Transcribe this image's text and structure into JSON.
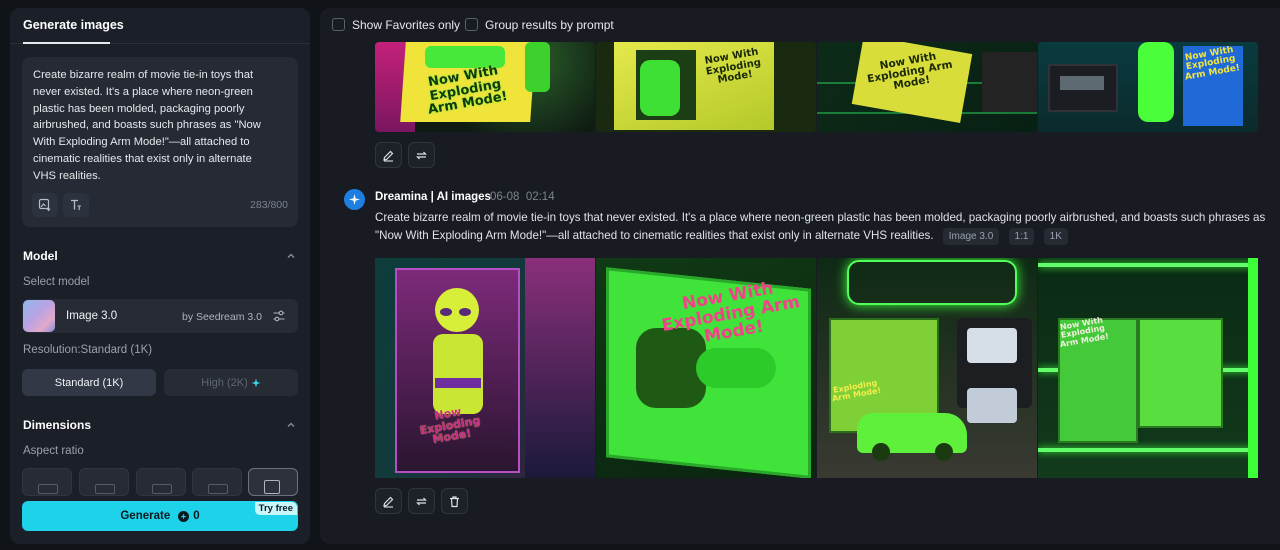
{
  "left_panel": {
    "tab": "Generate images",
    "prompt": {
      "text": "Create bizarre realm of movie tie-in toys that never existed. It's a place where neon-green plastic has been molded, packaging poorly airbrushed, and boasts such phrases as \"Now With Exploding Arm Mode!\"—all attached to cinematic realities that exist only in alternate VHS realities.",
      "char_count": "283/800"
    },
    "model_section": {
      "title": "Model",
      "select_label": "Select model",
      "model_name": "Image 3.0",
      "model_by": "by Seedream 3.0",
      "resolution_label": "Resolution:Standard (1K)",
      "standard_label": "Standard (1K)",
      "high_label": "High (2K)"
    },
    "dimensions_section": {
      "title": "Dimensions",
      "aspect_label": "Aspect ratio"
    },
    "generate": {
      "label": "Generate",
      "cost": "0",
      "badge": "Try free"
    }
  },
  "right_panel": {
    "filters": {
      "favorites_label": "Show Favorites only",
      "group_label": "Group results by prompt"
    },
    "top_images": {
      "captions": [
        "Now With Exploding Arm Mode!",
        "Now With Exploding Mode!",
        "Now With Exploding Arm Mode!",
        "Now With Exploding Arm Mode!"
      ]
    },
    "generation": {
      "author": "Dreamina | AI images",
      "date": "06-08",
      "time": "02:14",
      "prompt": "Create bizarre realm of movie tie-in toys that never existed. It's a place where neon-green plastic has been molded, packaging poorly airbrushed, and boasts such phrases as \"Now With Exploding Arm Mode!\"—all attached to cinematic realities that exist only in alternate VHS realities.",
      "tags": [
        "Image 3.0",
        "1:1",
        "1K"
      ],
      "image_captions": [
        "Now Exploding Mode!",
        "Now With Exploding Arm Mode!",
        "Exploding Arm Mode!",
        "Now With Exploding Arm Mode!"
      ]
    }
  },
  "colors": {
    "accent": "#1ed2ea",
    "neon_green": "#3cff3a",
    "background": "#101318",
    "panel": "#1b1f27"
  },
  "icons": [
    "add-image-icon",
    "text-icon",
    "chevron-up-icon",
    "settings-sliders-icon",
    "sparkle-icon",
    "coin-icon",
    "edit-icon",
    "regenerate-icon",
    "delete-icon",
    "dreamina-logo-icon"
  ]
}
